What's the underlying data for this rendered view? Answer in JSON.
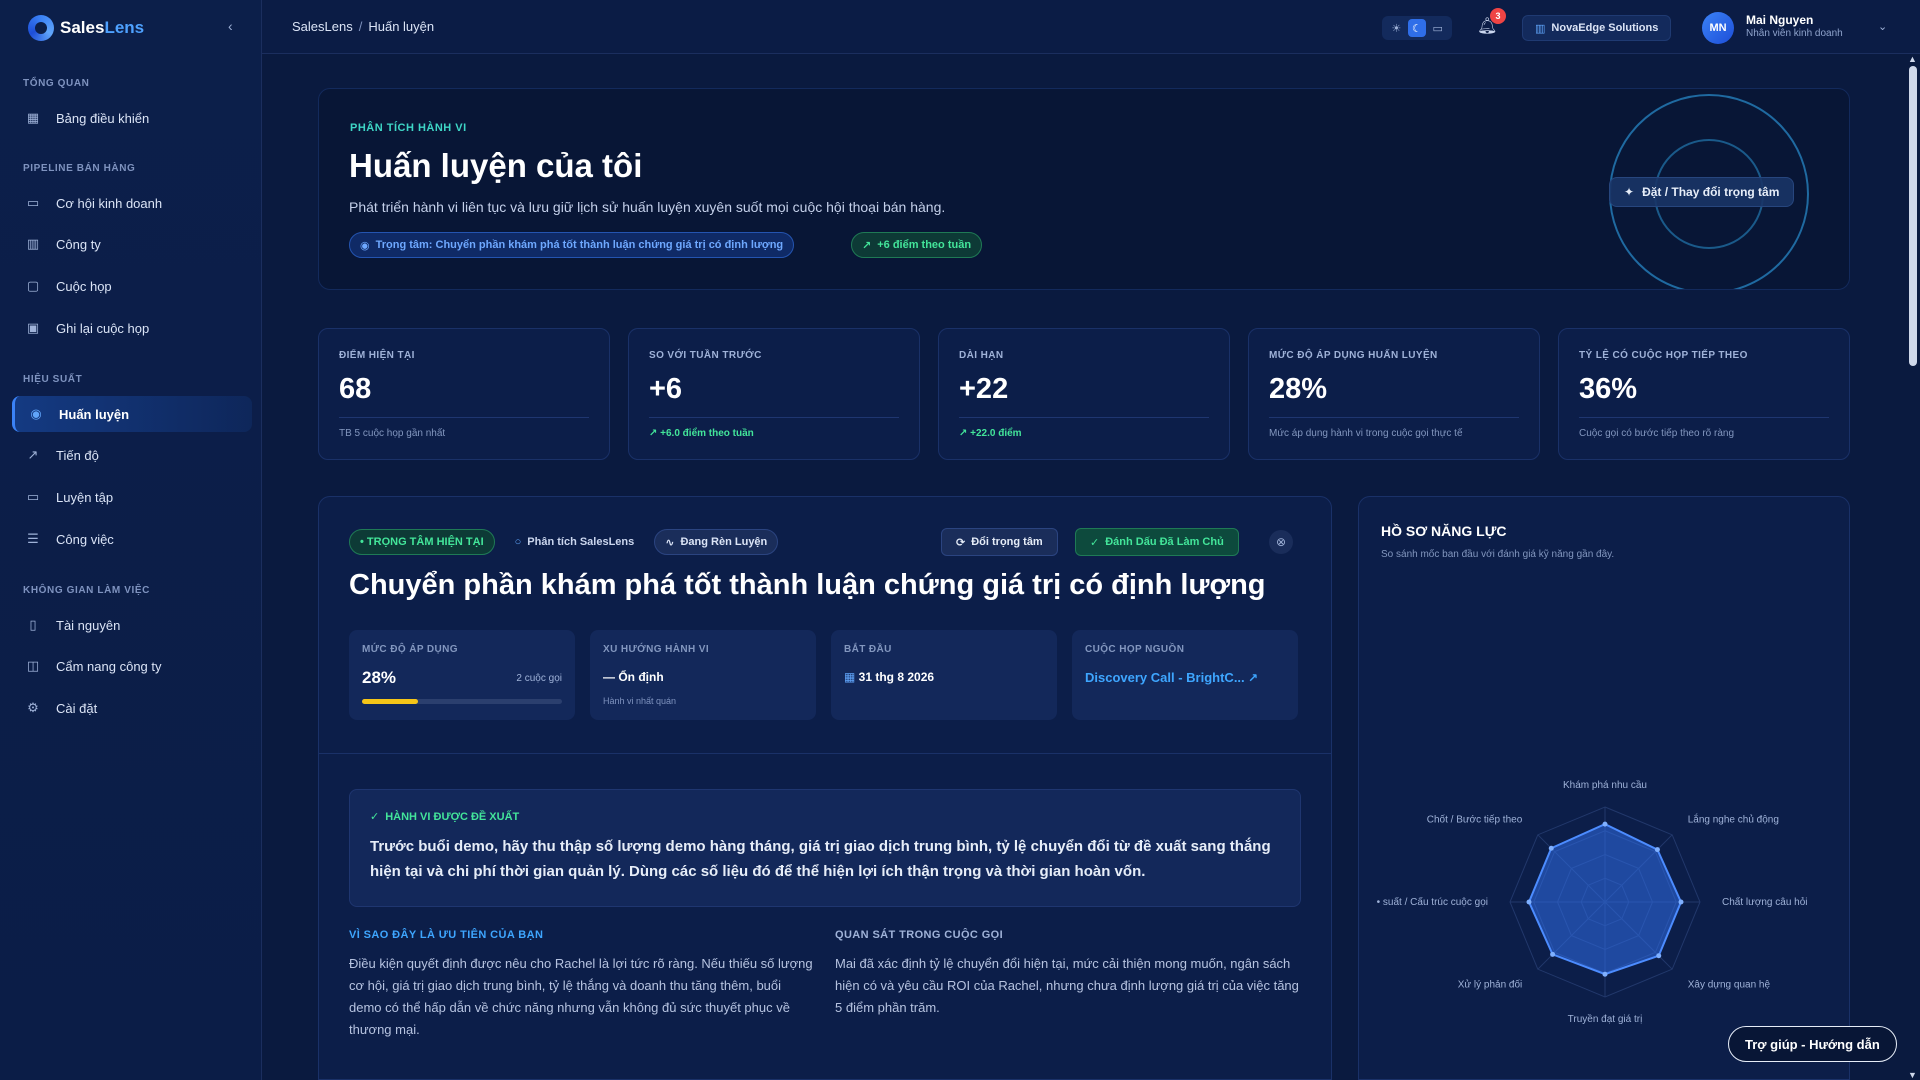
{
  "app": {
    "name_main": "Sales",
    "name_accent": "Lens"
  },
  "sidebar": {
    "collapse_icon": "chevron-left-icon",
    "sections": [
      {
        "title": "TỔNG QUAN"
      },
      {
        "title": "PIPELINE BÁN HÀNG"
      },
      {
        "title": "HIỆU SUẤT"
      },
      {
        "title": "KHÔNG GIAN LÀM VIỆC"
      }
    ],
    "items": [
      {
        "label": "Bảng điều khiển",
        "icon": "dashboard-icon"
      },
      {
        "label": "Cơ hội kinh doanh",
        "icon": "briefcase-icon"
      },
      {
        "label": "Công ty",
        "icon": "building-icon"
      },
      {
        "label": "Cuộc họp",
        "icon": "video-icon"
      },
      {
        "label": "Ghi lại cuộc họp",
        "icon": "recorder-icon"
      },
      {
        "label": "Huấn luyện",
        "icon": "target-icon",
        "active": true
      },
      {
        "label": "Tiến độ",
        "icon": "trend-icon"
      },
      {
        "label": "Luyện tập",
        "icon": "chat-icon"
      },
      {
        "label": "Công việc",
        "icon": "tasks-icon"
      },
      {
        "label": "Tài nguyên",
        "icon": "book-icon"
      },
      {
        "label": "Cẩm nang công ty",
        "icon": "open-book-icon"
      },
      {
        "label": "Cài đặt",
        "icon": "gear-icon"
      }
    ]
  },
  "header": {
    "breadcrumb": [
      "SalesLens",
      "Huấn luyện"
    ],
    "notification_count": "3",
    "org": "NovaEdge Solutions",
    "user": {
      "initials": "MN",
      "name": "Mai Nguyen",
      "role": "Nhân viên kinh doanh"
    }
  },
  "hero": {
    "eyebrow": "PHÂN TÍCH HÀNH VI",
    "title": "Huấn luyện của tôi",
    "subtitle": "Phát triển hành vi liên tục và lưu giữ lịch sử huấn luyện xuyên suốt mọi cuộc hội thoại bán hàng.",
    "focus_pill": "Trọng tâm: Chuyển phần khám phá tốt thành luận chứng giá trị có định lượng",
    "delta_pill": "+6 điểm theo tuần",
    "set_focus_button": "Đặt / Thay đổi trọng tâm"
  },
  "stats": [
    {
      "label": "ĐIỂM HIỆN TẠI",
      "value": "68",
      "foot": "TB 5 cuộc họp gần nhất",
      "foot_green": false
    },
    {
      "label": "SO VỚI TUẦN TRƯỚC",
      "value": "+6",
      "foot": "↗ +6.0 điểm theo tuần",
      "foot_green": true
    },
    {
      "label": "DÀI HẠN",
      "value": "+22",
      "foot": "↗ +22.0 điểm",
      "foot_green": true
    },
    {
      "label": "MỨC ĐỘ ÁP DỤNG HUẤN LUYỆN",
      "value": "28%",
      "foot": "Mức áp dụng hành vi trong cuộc gọi thực tế",
      "foot_green": false
    },
    {
      "label": "TỶ LỆ CÓ CUỘC HỌP TIẾP THEO",
      "value": "36%",
      "foot": "Cuộc gọi có bước tiếp theo rõ ràng",
      "foot_green": false
    }
  ],
  "focus": {
    "tag_current": "• TRỌNG TÂM HIỆN TẠI",
    "tag_source": "Phân tích SalesLens",
    "tag_training": "Đang Rèn Luyện",
    "change_button": "Đổi trọng tâm",
    "master_button": "Đánh Dấu Đã Làm Chủ",
    "title": "Chuyển phần khám phá tốt thành luận chứng giá trị có định lượng",
    "adoption": {
      "label": "MỨC ĐỘ ÁP DỤNG",
      "value": "28%",
      "calls": "2 cuộc gọi",
      "progress": 0.28
    },
    "trend": {
      "label": "XU HƯỚNG HÀNH VI",
      "value": "— Ổn định",
      "sub": "Hành vi nhất quán"
    },
    "start": {
      "label": "BẮT ĐẦU",
      "value": "31 thg 8 2026"
    },
    "source": {
      "label": "CUỘC HỌP NGUỒN",
      "value": "Discovery Call - BrightC..."
    },
    "recommended_label": "HÀNH VI ĐƯỢC ĐỀ XUẤT",
    "recommended_text": "Trước buổi demo, hãy thu thập số lượng demo hàng tháng, giá trị giao dịch trung bình, tỷ lệ chuyển đổi từ đề xuất sang thắng hiện tại và chi phí thời gian quản lý. Dùng các số liệu đó để thể hiện lợi ích thận trọng và thời gian hoàn vốn.",
    "why_label": "VÌ SAO ĐÂY LÀ ƯU TIÊN CỦA BẠN",
    "why_text": "Điều kiện quyết định được nêu cho Rachel là lợi tức rõ ràng. Nếu thiếu số lượng cơ hội, giá trị giao dịch trung bình, tỷ lệ thắng và doanh thu tăng thêm, buổi demo có thể hấp dẫn về chức năng nhưng vẫn không đủ sức thuyết phục về thương mại.",
    "obs_label": "QUAN SÁT TRONG CUỘC GỌI",
    "obs_text": "Mai đã xác định tỷ lệ chuyển đổi hiện tại, mức cải thiện mong muốn, ngân sách hiện có và yêu cầu ROI của Rachel, nhưng chưa định lượng giá trị của việc tăng 5 điểm phần trăm."
  },
  "profile": {
    "title": "HỒ SƠ NĂNG LỰC",
    "subtitle": "So sánh mốc ban đầu với đánh giá kỹ năng gần đây.",
    "axes": [
      "Khám phá nhu cầu",
      "Lắng nghe chủ động",
      "Chất lượng câu hỏi",
      "Xây dựng quan hệ",
      "Truyền đạt giá trị",
      "Xử lý phản đối",
      "• suất / Cấu trúc cuộc gọi",
      "Chốt / Bước tiếp theo"
    ],
    "values": [
      0.82,
      0.78,
      0.8,
      0.8,
      0.76,
      0.78,
      0.8,
      0.8
    ]
  },
  "help_button": "Trợ giúp - Hướng dẫn",
  "colors": {
    "accent": "#3b82f6",
    "teal": "#3ed6c6",
    "green": "#43e59a",
    "progress": "#f5c518"
  }
}
